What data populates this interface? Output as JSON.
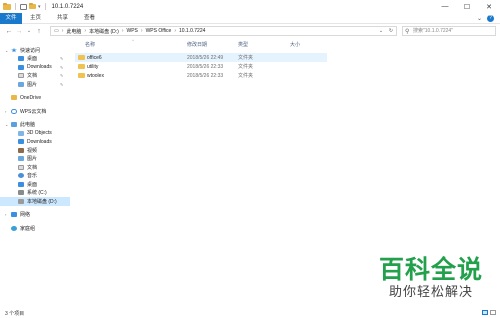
{
  "window": {
    "title": "10.1.0.7224",
    "minimize": "—",
    "maximize": "☐",
    "close": "✕"
  },
  "ribbon": {
    "tabs": [
      "文件",
      "主页",
      "共享",
      "查看"
    ],
    "expand": "⌄"
  },
  "address": {
    "crumbs": [
      "此电脑",
      "本地磁盘 (D:)",
      "WPS",
      "WPS Office",
      "10.1.0.7224"
    ],
    "search_placeholder": "搜索\"10.1.0.7224\""
  },
  "sidebar": {
    "quick_access": "快速访问",
    "quick_items": [
      "桌面",
      "Downloads",
      "文档",
      "图片"
    ],
    "onedrive": "OneDrive",
    "wps_cloud": "WPS云文档",
    "this_pc": "此电脑",
    "pc_items": [
      "3D Objects",
      "Downloads",
      "视频",
      "图片",
      "文档",
      "音乐",
      "桌面",
      "系统 (C:)",
      "本地磁盘 (D:)"
    ],
    "network": "网络",
    "homegroup": "家庭组"
  },
  "columns": {
    "name": "名称",
    "date": "修改日期",
    "type": "类型",
    "size": "大小"
  },
  "files": [
    {
      "name": "office6",
      "date": "2018/5/26 22:49",
      "type": "文件夹"
    },
    {
      "name": "utility",
      "date": "2018/5/26 22:33",
      "type": "文件夹"
    },
    {
      "name": "wtoolex",
      "date": "2018/5/26 22:33",
      "type": "文件夹"
    }
  ],
  "status": {
    "count": "3 个项目"
  },
  "watermark": {
    "title": "百科全说",
    "subtitle": "助你轻松解决"
  }
}
